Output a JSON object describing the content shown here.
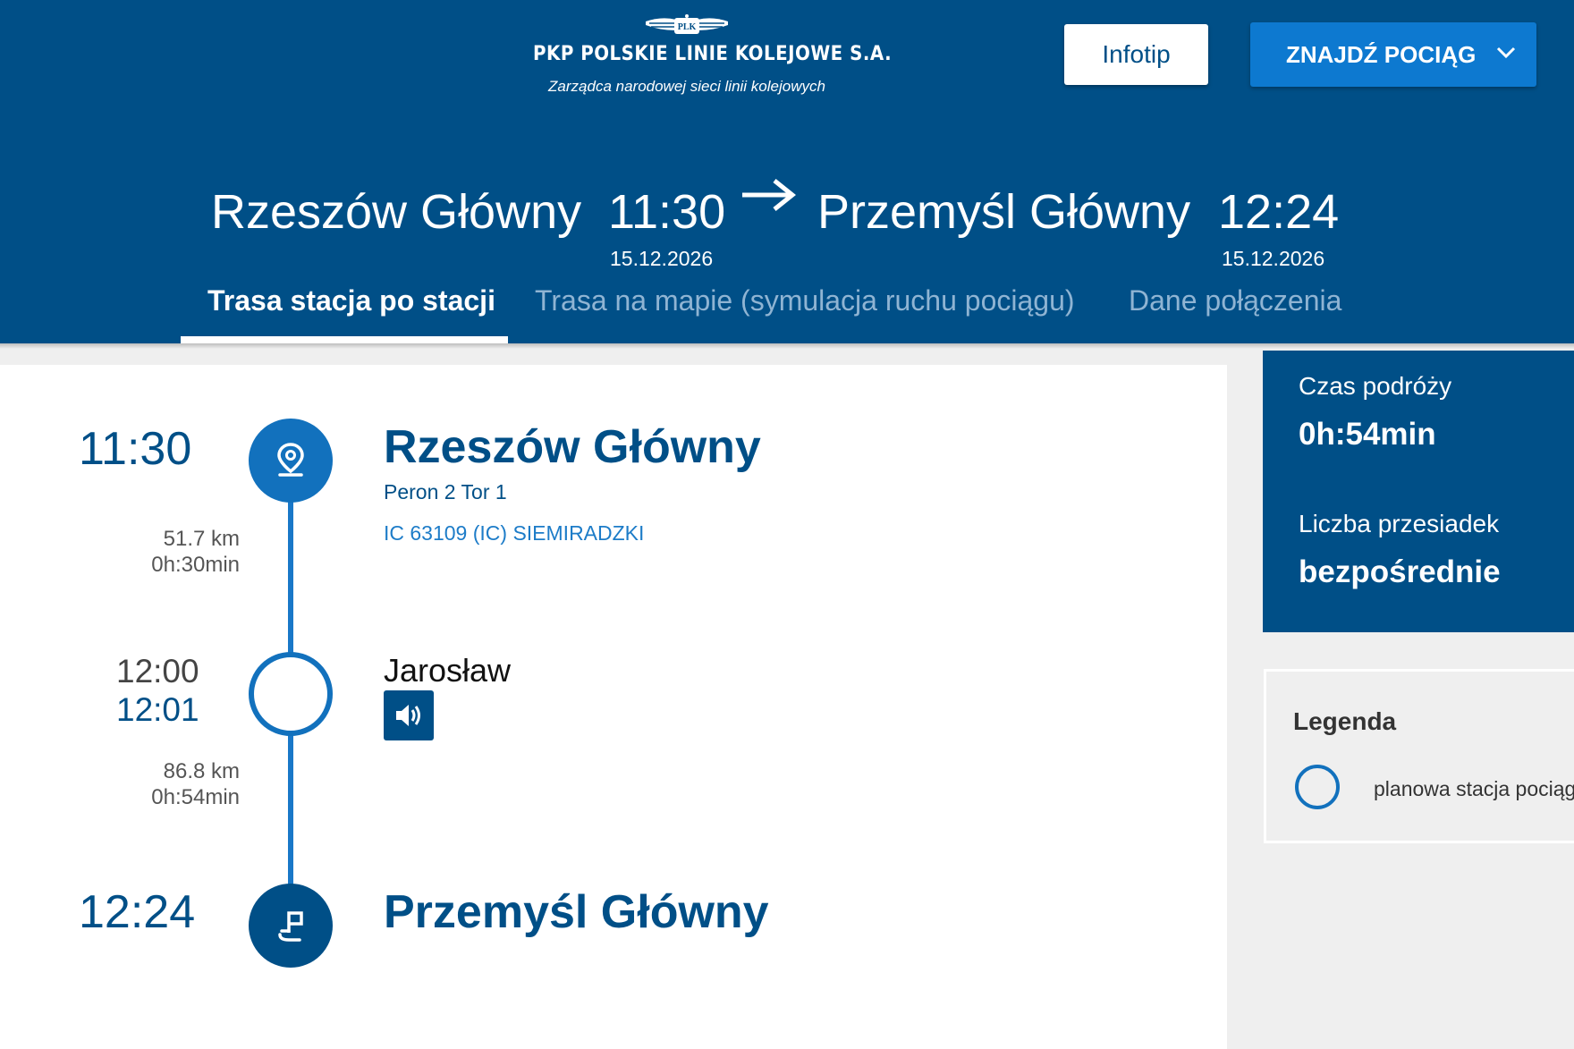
{
  "header": {
    "logo_badge": "PLK",
    "logo_name": "PKP POLSKIE LINIE KOLEJOWE S.A.",
    "logo_tagline": "Zarządca narodowej sieci linii kolejowych",
    "infotip_label": "Infotip",
    "find_train_label": "ZNAJDŹ POCIĄG"
  },
  "route": {
    "from_station": "Rzeszów Główny",
    "from_time": "11:30",
    "from_date": "15.12.2026",
    "to_station": "Przemyśl Główny",
    "to_time": "12:24",
    "to_date": "15.12.2026"
  },
  "tabs": [
    {
      "label": "Trasa stacja po stacji",
      "active": true
    },
    {
      "label": "Trasa na mapie (symulacja ruchu pociągu)",
      "active": false
    },
    {
      "label": "Dane połączenia",
      "active": false
    }
  ],
  "timeline": {
    "start": {
      "time": "11:30",
      "station": "Rzeszów Główny",
      "platform": "Peron 2 Tor 1",
      "train": "IC 63109 (IC) SIEMIRADZKI"
    },
    "segment1": {
      "distance": "51.7 km",
      "duration": "0h:30min"
    },
    "stop": {
      "arrival": "12:00",
      "departure": "12:01",
      "station": "Jarosław"
    },
    "segment2": {
      "distance": "86.8 km",
      "duration": "0h:54min"
    },
    "end": {
      "time": "12:24",
      "station": "Przemyśl Główny"
    }
  },
  "summary": {
    "travel_time_label": "Czas podróży",
    "travel_time_value": "0h:54min",
    "transfers_label": "Liczba przesiadek",
    "transfers_value": "bezpośrednie"
  },
  "legend": {
    "title": "Legenda",
    "item": "planowa stacja pociągu"
  },
  "colors": {
    "header_bg": "#004f87",
    "accent_blue": "#1271bd",
    "button_blue": "#0d79d0"
  }
}
